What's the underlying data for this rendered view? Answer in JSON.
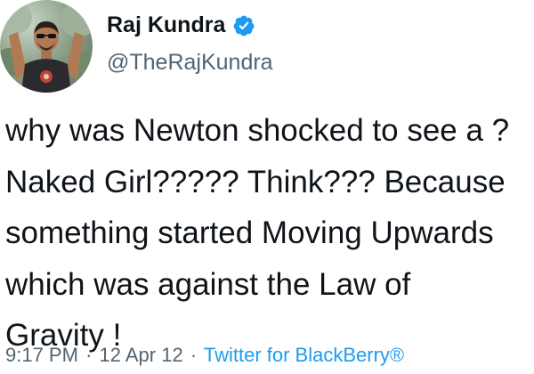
{
  "user": {
    "name": "Raj Kundra",
    "handle": "@TheRajKundra",
    "verified": true
  },
  "tweet": {
    "lines": [
      "why was Newton shocked to see a ?",
      "Naked Girl????? Think??? Because",
      "something started Moving Upwards",
      "which was against the Law of",
      "Gravity !"
    ]
  },
  "meta": {
    "time": "9:17 PM",
    "separator": "·",
    "date": "12 Apr 12",
    "source": "Twitter for BlackBerry®"
  },
  "colors": {
    "verified": "#1d9bf0",
    "secondary_text": "#536471",
    "link": "#1d9bf0"
  }
}
